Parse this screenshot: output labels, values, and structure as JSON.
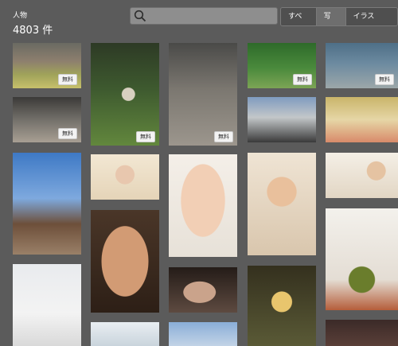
{
  "header": {
    "category": "人物",
    "count": "4803 件",
    "search": {
      "placeholder": ""
    },
    "tabs": [
      {
        "label": "すべて",
        "active": false
      },
      {
        "label": "写真",
        "active": true
      },
      {
        "label": "イラスト",
        "active": false
      }
    ]
  },
  "badges": {
    "free": "無料"
  }
}
